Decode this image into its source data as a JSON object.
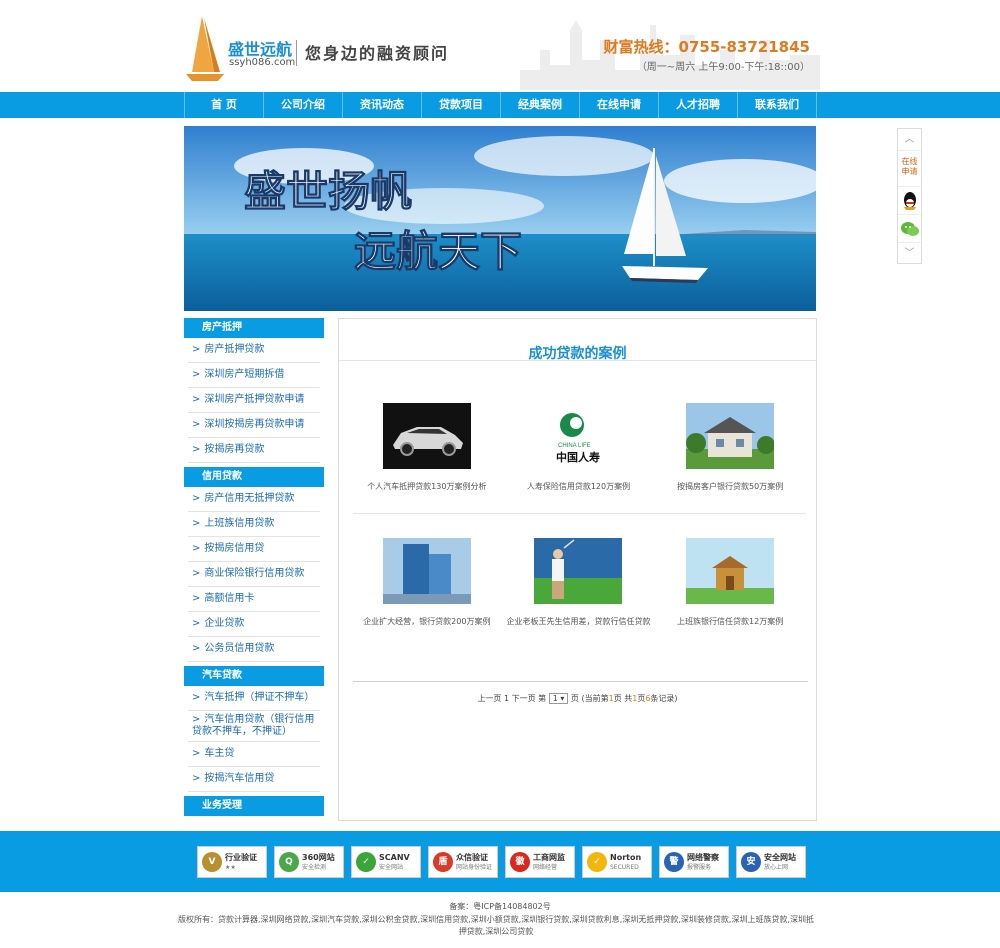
{
  "header": {
    "brand_name": "盛世远航",
    "brand_url": "ssyh086.com",
    "slogan": "您身边的融资顾问",
    "hotline": "财富热线：0755-83721845",
    "hours": "（周一~周六 上午9:00-下午:18::00）"
  },
  "nav": {
    "items": [
      {
        "label": "首 页"
      },
      {
        "label": "公司介绍"
      },
      {
        "label": "资讯动态"
      },
      {
        "label": "贷款项目"
      },
      {
        "label": "经典案例"
      },
      {
        "label": "在线申请"
      },
      {
        "label": "人才招聘"
      },
      {
        "label": "联系我们"
      }
    ]
  },
  "banner": {
    "line1": "盛世扬帆",
    "line2": "远航天下"
  },
  "sidebar": {
    "groups": [
      {
        "title": "房产抵押",
        "items": [
          "房产抵押贷款",
          "深圳房产短期拆借",
          "深圳房产抵押贷款申请",
          "深圳按揭房再贷款申请",
          "按揭房再贷款"
        ]
      },
      {
        "title": "信用贷款",
        "items": [
          "房产信用无抵押贷款",
          "上班族信用贷款",
          "按揭房信用贷",
          "商业保险银行信用贷款",
          "高额信用卡",
          "企业贷款",
          "公务员信用贷款"
        ]
      },
      {
        "title": "汽车贷款",
        "items": [
          "汽车抵押（押证不押车）",
          "汽车信用贷款（银行信用贷款不押车，不押证）",
          "车主贷",
          "按揭汽车信用贷"
        ]
      },
      {
        "title": "业务受理",
        "items": []
      }
    ]
  },
  "content": {
    "title": "成功贷款的案例",
    "cases": [
      {
        "caption": "个人汽车抵押贷款130万案例分析",
        "thumb": "car"
      },
      {
        "caption": "人寿保险信用贷款120万案例",
        "thumb": "china-life",
        "logo_en": "CHINA LIFE",
        "logo_cn": "中国人寿"
      },
      {
        "caption": "按揭房客户银行贷款50万案例",
        "thumb": "house"
      },
      {
        "caption": "企业扩大经营，银行贷款200万案例",
        "thumb": "building"
      },
      {
        "caption": "企业老板王先生信用差，贷款行信任贷款",
        "thumb": "golf"
      },
      {
        "caption": "上班族银行信任贷款12万案例",
        "thumb": "blocks"
      }
    ],
    "pager": {
      "prev": "上一页",
      "current": "1",
      "next": "下一页",
      "jump_prefix": "第",
      "jump_value": "1",
      "jump_suffix": "页",
      "info_prefix": "(当前第",
      "info_page": "1",
      "info_mid": "页 共",
      "info_total": "1",
      "info_mid2": "页",
      "info_count": "6",
      "info_suffix": "条记录)"
    }
  },
  "float": {
    "online": "在线申请"
  },
  "footer": {
    "badges": [
      {
        "title": "行业验证",
        "sub": "★★",
        "color": "#b8912f"
      },
      {
        "title": "360网站",
        "sub": "安全检测",
        "color": "#4aa84a"
      },
      {
        "title": "SCANV",
        "sub": "安全网站",
        "color": "#3aa63a"
      },
      {
        "title": "众信验证",
        "sub": "网站身份验证",
        "color": "#d93b2b"
      },
      {
        "title": "工商网监",
        "sub": "网络经营",
        "color": "#d9291f"
      },
      {
        "title": "Norton",
        "sub": "SECURED",
        "color": "#f2b70f"
      },
      {
        "title": "网络警察",
        "sub": "报警服务",
        "color": "#2a62b8"
      },
      {
        "title": "安全网站",
        "sub": "放心上网",
        "color": "#2a62b8"
      }
    ],
    "icp": "备案：粤ICP备14084802号",
    "copyright": "版权所有：贷款计算器,深圳网络贷款,深圳汽车贷款,深圳公积金贷款,深圳信用贷款,深圳小额贷款,深圳银行贷款,深圳贷款利息,深圳无抵押贷款,深圳装修贷款,深圳上班族贷款,深圳抵押贷款,深圳公司贷款"
  }
}
